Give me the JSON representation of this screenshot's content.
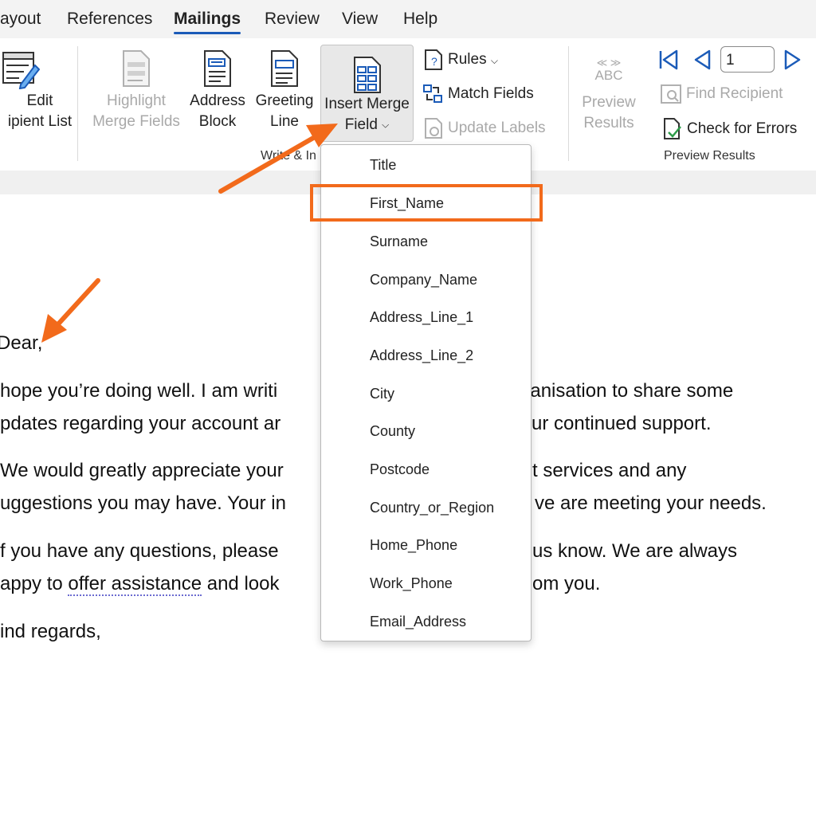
{
  "menu": {
    "tabs": [
      {
        "label": "ayout"
      },
      {
        "label": "References"
      },
      {
        "label": "Mailings"
      },
      {
        "label": "Review"
      },
      {
        "label": "View"
      },
      {
        "label": "Help"
      }
    ],
    "active_tab": "Mailings"
  },
  "ribbon": {
    "edit_recipient": {
      "line1": "Edit",
      "line2": "ipient List"
    },
    "highlight": {
      "line1": "Highlight",
      "line2": "Merge Fields"
    },
    "address": {
      "line1": "Address",
      "line2": "Block"
    },
    "greeting": {
      "line1": "Greeting",
      "line2": "Line"
    },
    "insert_merge": {
      "line1": "Insert Merge",
      "line2": "Field"
    },
    "rules": "Rules",
    "match_fields": "Match Fields",
    "update_labels": "Update Labels",
    "group_write_insert": "Write & In",
    "preview": {
      "icon_text": "ABC",
      "line1": "Preview",
      "line2": "Results"
    },
    "record_number": "1",
    "find_recipient": "Find Recipient",
    "check_errors": "Check for Errors",
    "group_preview": "Preview Results"
  },
  "document": {
    "salutation": "Dear",
    "salutation_comma": ",",
    "p1_left_1": "hope you’re doing well. I am writi",
    "p1_right_1": "ganisation to share some",
    "p1_left_2": "pdates regarding your account ar",
    "p1_right_2": "ur continued support.",
    "p2_left_1": "We would greatly appreciate your",
    "p2_right_1": "t services and any",
    "p2_left_2": "uggestions you may have. Your in",
    "p2_right_2": "ve are meeting your needs.",
    "p3_left_1": "f you have any questions, please",
    "p3_right_1": "us know. We are always",
    "p3_left_2a": "appy to ",
    "p3_left_2b": "offer assistance",
    "p3_left_2c": " and look",
    "p3_right_2": "om you.",
    "closing": "ind regards,"
  },
  "dropdown": {
    "items": [
      "Title",
      "First_Name",
      "Surname",
      "Company_Name",
      "Address_Line_1",
      "Address_Line_2",
      "City",
      "County",
      "Postcode",
      "Country_or_Region",
      "Home_Phone",
      "Work_Phone",
      "Email_Address"
    ],
    "highlighted": "First_Name"
  },
  "colors": {
    "annotation": "#f26a1b",
    "accent_blue": "#1b5bb8"
  }
}
